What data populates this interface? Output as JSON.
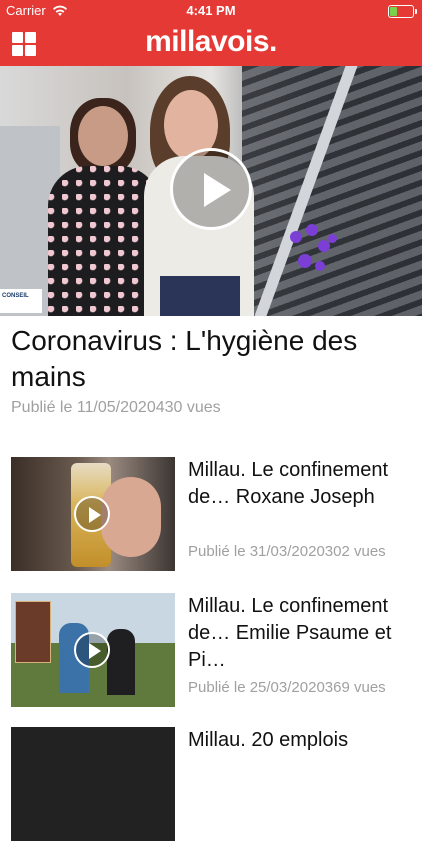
{
  "status": {
    "carrier": "Carrier",
    "time": "4:41 PM"
  },
  "header": {
    "logo": "millavois."
  },
  "hero": {
    "badge": "CONSEIL",
    "title": "Coronavirus : L'hygiène des mains",
    "meta": "Publié le 11/05/2020430 vues"
  },
  "articles": [
    {
      "title": "Millau. Le confinement de… Roxane Joseph",
      "meta": "Publié le 31/03/2020302 vues"
    },
    {
      "title": "Millau. Le confinement de… Emilie Psaume et Pi…",
      "meta": "Publié le 25/03/2020369 vues"
    },
    {
      "title": "Millau. 20 emplois",
      "meta": ""
    }
  ],
  "colors": {
    "brand": "#e53935",
    "meta": "#a0a0a0",
    "battery": "#7bd14c"
  }
}
